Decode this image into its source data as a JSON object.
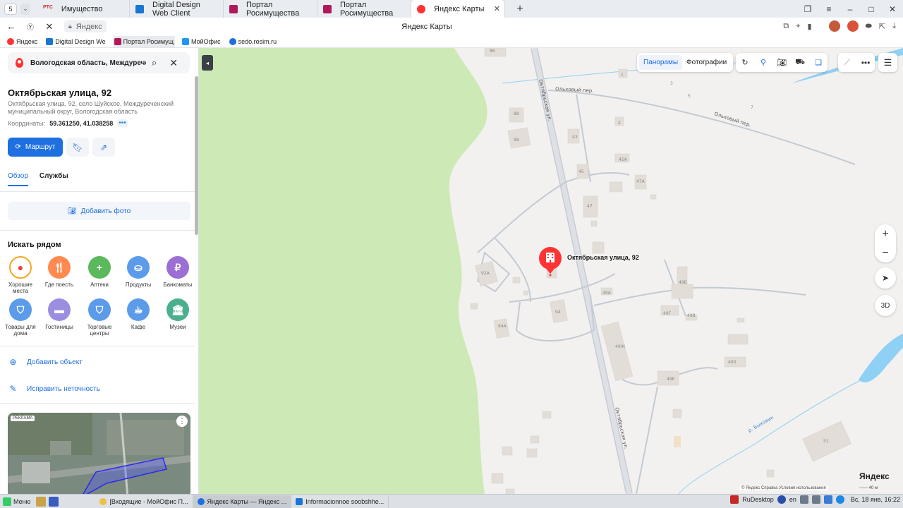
{
  "browser": {
    "tab_count": "5",
    "tabs": [
      {
        "label": "Имущество",
        "favicon": "rts-logo",
        "color": "#d32f2f"
      },
      {
        "label": "Digital Design Web Client",
        "favicon": "dd-icon",
        "color": "#1976d2"
      },
      {
        "label": "Портал Росимущества",
        "favicon": "rosim-icon",
        "color": "#b0185a"
      },
      {
        "label": "Портал Росимущества",
        "favicon": "rosim-icon",
        "color": "#b0185a"
      },
      {
        "label": "Яндекс Карты",
        "favicon": "yandex-maps-icon",
        "color": "#f33",
        "active": true
      }
    ],
    "rts_badge": "РТС",
    "address": "Яндекс",
    "page_title": "Яндекс Карты",
    "bookmarks": [
      {
        "label": "Яндекс",
        "color": "#f33"
      },
      {
        "label": "Digital Design We",
        "color": "#1976d2"
      },
      {
        "label": "Портал Росимущ",
        "color": "#b0185a"
      },
      {
        "label": "МойОфис",
        "color": "#2196f3"
      },
      {
        "label": "sedo.rosim.ru",
        "color": "#1e6fe0"
      }
    ]
  },
  "panel": {
    "search_value": "Вологодская область, Междуреченс",
    "title": "Октябрьская улица, 92",
    "subtitle": "Октябрьская улица, 92, село Шуйское, Междуреченский муниципальный округ, Вологодская область",
    "coords_label": "Координаты:",
    "coords_value": "59.361250, 41.038258",
    "route_label": "Маршрут",
    "tabs": [
      "Обзор",
      "Службы"
    ],
    "add_photo": "Добавить фото",
    "nearby_title": "Искать рядом",
    "categories": [
      {
        "label": "Хорошие места",
        "icon": "pin-icon",
        "color": "#f5a623"
      },
      {
        "label": "Где поесть",
        "icon": "food-icon",
        "color": "#ff8a50"
      },
      {
        "label": "Аптеки",
        "icon": "plus-icon",
        "color": "#5cb85c"
      },
      {
        "label": "Продукты",
        "icon": "basket-icon",
        "color": "#5b9bea"
      },
      {
        "label": "Банкоматы",
        "icon": "ruble-icon",
        "color": "#9b6fd4"
      },
      {
        "label": "Товары для дома",
        "icon": "bag-icon",
        "color": "#5b9bea"
      },
      {
        "label": "Гостиницы",
        "icon": "bed-icon",
        "color": "#9b8ee0"
      },
      {
        "label": "Торговые центры",
        "icon": "bag-icon",
        "color": "#5b9bea"
      },
      {
        "label": "Кафе",
        "icon": "cup-icon",
        "color": "#5b9bea"
      },
      {
        "label": "Музеи",
        "icon": "museum-icon",
        "color": "#4caf8c"
      }
    ],
    "add_object": "Добавить объект",
    "fix_error": "Исправить неточность",
    "ad_tag": "РЕКЛАМА"
  },
  "map": {
    "layers": [
      "Панорамы",
      "Фотографии"
    ],
    "marker_label": "Октябрьская улица, 92",
    "street_labels": [
      "Октябрьская ул.",
      "Ольховый пер.",
      "Ольховый пер.",
      "Октябрьская ул.",
      "р. Быковик"
    ],
    "house_numbers": [
      "86",
      "1",
      "3",
      "5",
      "7",
      "88",
      "2",
      "98",
      "43",
      "45А",
      "45",
      "47А",
      "47",
      "92А",
      "49Б",
      "49А",
      "94",
      "49Г",
      "49В",
      "94А",
      "49Ж",
      "493",
      "49Е",
      "51"
    ],
    "zoom_in": "+",
    "zoom_out": "−",
    "btn_3d": "3D",
    "logo": "Яндекс",
    "attribution": "© Яндекс  Справка  Условия использования",
    "scale": "40 м"
  },
  "taskbar": {
    "start_label": "Меню",
    "tasks": [
      {
        "label": "[Входящие - МойОфис П...",
        "color": "#f0c040"
      },
      {
        "label": "Яндекс Карты — Яндекс ...",
        "color": "#1e6fe0",
        "active": true
      },
      {
        "label": "Informacionnoe soobshhe...",
        "color": "#1976d2"
      }
    ],
    "rudesktop": "RuDesktop",
    "lang": "en",
    "clock": "Вс, 18 янв, 16:22"
  }
}
